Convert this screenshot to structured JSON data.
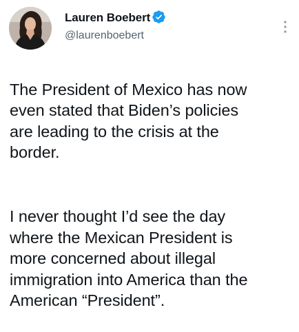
{
  "tweet": {
    "author": {
      "name": "Lauren Boebert",
      "handle": "@laurenboebert",
      "verified": true,
      "avatar_icon": "profile-photo"
    },
    "more_icon": "vertical-dots-icon",
    "paragraphs": [
      "The President of Mexico has now\neven stated that Biden’s policies\nare leading to the crisis at the\nborder.",
      "I never thought I’d see the day\nwhere the Mexican President is\nmore concerned about illegal\nimmigration into America than the\nAmerican “President”."
    ]
  },
  "colors": {
    "text": "#0f1419",
    "secondary_text": "#536471",
    "verified_blue": "#1d9bf0",
    "background": "#ffffff"
  }
}
